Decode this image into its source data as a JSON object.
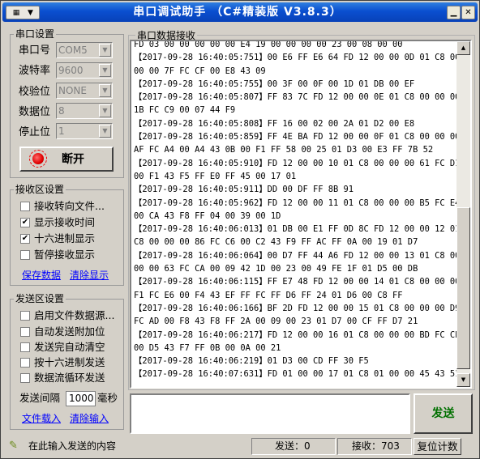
{
  "window": {
    "title": "串口调试助手 （C#精装版 V3.8.3）"
  },
  "serial_settings": {
    "group_label": "串口设置",
    "port_label": "串口号",
    "port_value": "COM5",
    "baud_label": "波特率",
    "baud_value": "9600",
    "parity_label": "校验位",
    "parity_value": "NONE",
    "databits_label": "数据位",
    "databits_value": "8",
    "stopbits_label": "停止位",
    "stopbits_value": "1",
    "open_button": "断开"
  },
  "receive_settings": {
    "group_label": "接收区设置",
    "options": [
      {
        "label": "接收转向文件...",
        "checked": false
      },
      {
        "label": "显示接收时间",
        "checked": true
      },
      {
        "label": "十六进制显示",
        "checked": true
      },
      {
        "label": "暂停接收显示",
        "checked": false
      }
    ],
    "save_link": "保存数据",
    "clear_link": "清除显示"
  },
  "send_settings": {
    "group_label": "发送区设置",
    "options": [
      {
        "label": "启用文件数据源...",
        "checked": false
      },
      {
        "label": "自动发送附加位",
        "checked": false
      },
      {
        "label": "发送完自动清空",
        "checked": false
      },
      {
        "label": "按十六进制发送",
        "checked": false
      },
      {
        "label": "数据流循环发送",
        "checked": false
      }
    ],
    "interval_label": "发送间隔",
    "interval_value": "1000",
    "interval_unit": "毫秒",
    "load_file_link": "文件载入",
    "clear_input_link": "清除输入"
  },
  "receive_area": {
    "title": "串口数据接收",
    "lines": [
      "FD 03 00 00 00 00 00 E4 19 00 00 00 00 23 00 08 00 00",
      "【2017-09-28 16:40:05:751】00 E6 FF E6 64 FD 12 00 00 0D 01 C8 00",
      "00 00 7F FC CF 00 E8 43 09",
      "【2017-09-28 16:40:05:755】00 3F 00 0F 00 1D 01 DB 00 EF",
      "【2017-09-28 16:40:05:807】FF 83 7C FD 12 00 00 0E 01 C8 00 00 00",
      "1B FC C9 00 07 44 F9",
      "【2017-09-28 16:40:05:808】FF 16 00 02 00 2A 01 D2 00 E8",
      "【2017-09-28 16:40:05:859】FF 4E BA FD 12 00 00 0F 01 C8 00 00 00",
      "AF FC A4 00 A4 43 0B 00 F1 FF 58 00 25 01 D3 00 E3 FF 7B 52",
      "【2017-09-28 16:40:05:910】FD 12 00 00 10 01 C8 00 00 00 61 FC D1",
      "00 F1 43 F5 FF E0 FF 45 00 17 01",
      "【2017-09-28 16:40:05:911】DD 00 DF FF 8B 91",
      "【2017-09-28 16:40:05:962】FD 12 00 00 11 01 C8 00 00 00 B5 FC E4",
      "00 CA 43 F8 FF 04 00 39 00 1D",
      "【2017-09-28 16:40:06:013】01 DB 00 E1 FF 0D 8C FD 12 00 00 12 01",
      "C8 00 00 00 86 FC C6 00 C2 43 F9 FF AC FF 0A 00 19 01 D7",
      "【2017-09-28 16:40:06:064】00 D7 FF 44 A6 FD 12 00 00 13 01 C8 00",
      "00 00 63 FC CA 00 09 42 1D 00 23 00 49 FE 1F 01 D5 00 DB",
      "【2017-09-28 16:40:06:115】FF E7 48 FD 12 00 00 14 01 C8 00 00 00",
      "F1 FC E6 00 F4 43 EF FF FC FF D6 FF 24 01 D6 00 C8 FF",
      "【2017-09-28 16:40:06:166】BF 2D FD 12 00 00 15 01 C8 00 00 00 D9",
      "FC AD 00 F8 43 F8 FF 2A 00 09 00 23 01 D7 00 CF FF D7 21",
      "【2017-09-28 16:40:06:217】FD 12 00 00 16 01 C8 00 00 00 BD FC CE",
      "00 D5 43 F7 FF 0B 00 0A 00 21",
      "【2017-09-28 16:40:06:219】01 D3 00 CD FF 30 F5",
      "【2017-09-28 16:40:07:631】FD 01 00 00 17 01 C8 01 00 00 45 43 51"
    ]
  },
  "send_area": {
    "value": "",
    "send_button": "发送"
  },
  "status_bar": {
    "hint": "在此输入发送的内容",
    "sent": "发送：0",
    "received": "接收：703",
    "reset_button": "复位计数"
  }
}
